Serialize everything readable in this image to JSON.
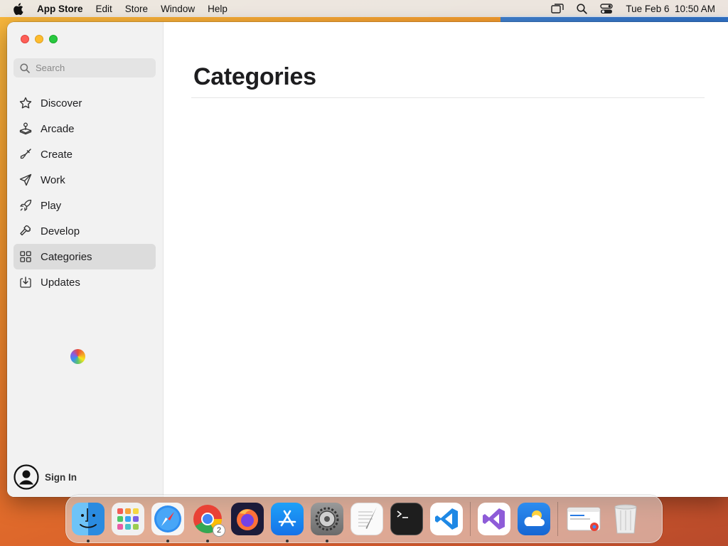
{
  "menubar": {
    "app_name": "App Store",
    "items": [
      "Edit",
      "Store",
      "Window",
      "Help"
    ],
    "datetime": "Tue Feb 6  10:50 AM"
  },
  "sidebar": {
    "search_placeholder": "Search",
    "items": [
      {
        "label": "Discover",
        "icon": "star-icon"
      },
      {
        "label": "Arcade",
        "icon": "joystick-icon"
      },
      {
        "label": "Create",
        "icon": "brush-icon"
      },
      {
        "label": "Work",
        "icon": "paperplane-icon"
      },
      {
        "label": "Play",
        "icon": "rocket-icon"
      },
      {
        "label": "Develop",
        "icon": "hammer-icon"
      },
      {
        "label": "Categories",
        "icon": "grid-icon",
        "active": true
      },
      {
        "label": "Updates",
        "icon": "download-icon"
      }
    ],
    "sign_in": "Sign In"
  },
  "main": {
    "title": "Categories"
  },
  "dock": {
    "apps": [
      {
        "name": "Finder",
        "running": true
      },
      {
        "name": "Launchpad",
        "running": false
      },
      {
        "name": "Safari",
        "running": true
      },
      {
        "name": "Chrome",
        "running": true,
        "badge": "2"
      },
      {
        "name": "Firefox",
        "running": false
      },
      {
        "name": "App Store",
        "running": true
      },
      {
        "name": "System Settings",
        "running": true
      },
      {
        "name": "TextEdit",
        "running": false
      },
      {
        "name": "Terminal",
        "running": false
      },
      {
        "name": "VS Code",
        "running": false
      },
      {
        "name": "Visual Studio",
        "running": false
      },
      {
        "name": "Weather",
        "running": false
      },
      {
        "name": "Chrome Window",
        "running": false
      },
      {
        "name": "Trash",
        "running": false
      }
    ]
  }
}
